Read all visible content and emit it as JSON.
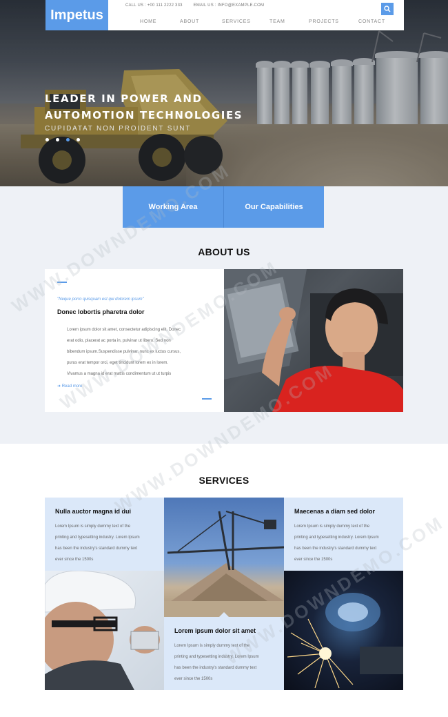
{
  "header": {
    "logo": "Impetus",
    "contact_phone": "CALL US : +00 111 2222 333",
    "contact_email": "EMAIL US : INFO@EXAMPLE.COM",
    "search_icon": "search-icon",
    "nav": [
      "HOME",
      "ABOUT",
      "SERVICES",
      "TEAM",
      "PROJECTS",
      "CONTACT"
    ]
  },
  "hero": {
    "title": "LEADER IN POWER AND AUTOMOTION TECHNOLOGIES",
    "subtitle": "CUPIDATAT NON PROIDENT SUNT",
    "slide_count": 4,
    "active_slide": 3
  },
  "features": {
    "tabs": [
      "Working Area",
      "Our Capabilities"
    ]
  },
  "about": {
    "title": "ABOUT US",
    "quote": "\"Neque porro quisquam est qui dolorem ipsum\"",
    "heading": "Donec lobortis pharetra dolor",
    "lines": [
      "Lorem ipsum dolor sit amet, consectetur adipiscing elit. Donec",
      "erat odio, placerat ac porta in, pulvinar ut libero. Sed non",
      "bibendum ipsum.Suspendisse pulvinar, nunc ex luctus cursus,",
      "purus erat tempor orci, eget tincidunt lorem ex in lorem.",
      "Vivamus a magna id erat mattis condimentum ut ut turpis"
    ],
    "read_more": "Read more"
  },
  "services": {
    "title": "SERVICES",
    "items": [
      {
        "title": "Nulla auctor magna id dui",
        "lines": [
          "Lorem Ipsum is simply dummy text of the",
          "printing and typesetting industry. Lorem Ipsum",
          "has been the industry's standard dummy text",
          "ever since the 1500s"
        ]
      },
      {
        "title": "Maecenas a diam sed dolor",
        "lines": [
          "Lorem Ipsum is simply dummy text of the",
          "printing and typesetting industry. Lorem Ipsum",
          "has been the industry's standard dummy text",
          "ever since the 1500s"
        ]
      },
      {
        "title": "Lorem ipsum dolor sit amet",
        "lines": [
          "Lorem Ipsum is simply dummy text of the",
          "printing and typesetting industry. Lorem Ipsum",
          "has been the industry's standard dummy text",
          "ever since the 1500s"
        ]
      }
    ]
  },
  "watermark": "WWW.DOWNDEMO.COM",
  "colors": {
    "accent": "#5b9be8",
    "light_panel": "#dbe8f9",
    "page_bg": "#eef1f6"
  }
}
